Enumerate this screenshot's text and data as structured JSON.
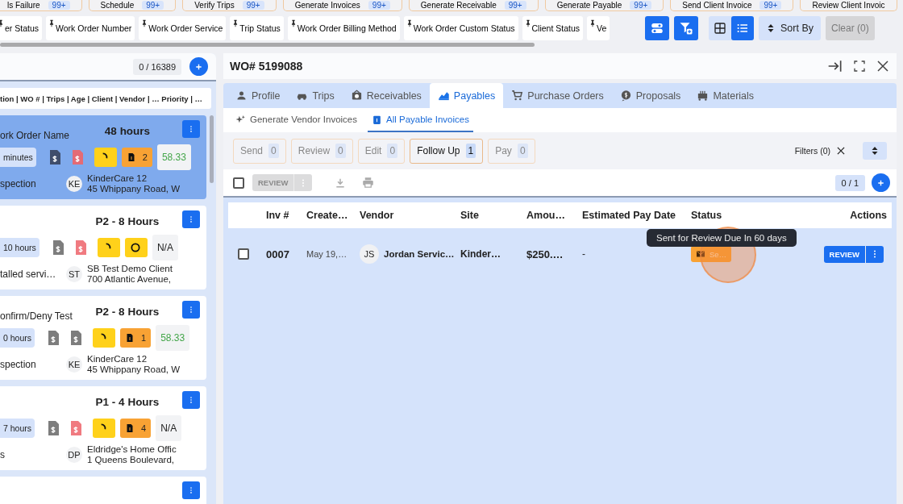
{
  "top_chips": [
    {
      "label": "ls Failure",
      "count": "99+"
    },
    {
      "label": "Schedule",
      "count": "99+"
    },
    {
      "label": "Verify Trips",
      "count": "99+"
    },
    {
      "label": "Generate Invoices",
      "count": "99+"
    },
    {
      "label": "Generate Receivable",
      "count": "99+"
    },
    {
      "label": "Generate Payable",
      "count": "99+"
    },
    {
      "label": "Send Client Invoice",
      "count": "99+"
    },
    {
      "label": "Review Client Invoic"
    }
  ],
  "pinned_filters": [
    "er Status",
    "Work Order Number",
    "Work Order Service",
    "Trip Status",
    "Work Order Billing Method",
    "Work Order Custom Status",
    "Client Status",
    "Ve"
  ],
  "toolbar": {
    "views": [
      {
        "kind": "grid",
        "selected": false
      },
      {
        "kind": "list",
        "selected": true
      }
    ],
    "sort_label": "Sort By",
    "clear_label": "Clear (0)",
    "clear_disabled": true
  },
  "list": {
    "count": "0 / 16389",
    "columns_label": "tion | WO # | Trips | Age | Client | Vendor | …  Priority | …",
    "cards": [
      {
        "selected": true,
        "name": "ork Order Name",
        "priority": "48 hours",
        "age": "minutes",
        "invoice_icons": [
          {
            "color": "#3f4d6b"
          },
          {
            "color": "#e46b75"
          }
        ],
        "badges": [
          {
            "kind": "spinner"
          },
          {
            "kind": "docs",
            "count": "2"
          },
          {
            "kind": "percent",
            "text": "58.33"
          }
        ],
        "service": "spection",
        "initials": "KE",
        "site": "KinderCare 12",
        "address": "45 Whippany Road, W"
      },
      {
        "selected": false,
        "priority": "P2 - 8 Hours",
        "age": "10 hours",
        "invoice_icons": [
          {
            "color": "#7d7d7d"
          },
          {
            "color": "#f07a80"
          }
        ],
        "badges": [
          {
            "kind": "spinner"
          },
          {
            "kind": "ring"
          },
          {
            "kind": "na",
            "text": "N/A"
          }
        ],
        "service": "talled servi…",
        "initials": "ST",
        "site": "SB Test Demo Client",
        "address": "700 Atlantic Avenue,"
      },
      {
        "selected": false,
        "name": "onfirm/Deny Test",
        "priority": "P2 - 8 Hours",
        "age": "0 hours",
        "invoice_icons": [
          {
            "color": "#7d7d7d"
          },
          {
            "color": "#7d7d7d"
          }
        ],
        "badges": [
          {
            "kind": "spinner"
          },
          {
            "kind": "docs",
            "count": "1"
          },
          {
            "kind": "percent",
            "text": "58.33"
          }
        ],
        "service": "spection",
        "initials": "KE",
        "site": "KinderCare 12",
        "address": "45 Whippany Road, W"
      },
      {
        "selected": false,
        "priority": "P1 - 4 Hours",
        "age": "7 hours",
        "invoice_icons": [
          {
            "color": "#7d7d7d"
          },
          {
            "color": "#f07a80"
          }
        ],
        "badges": [
          {
            "kind": "spinner"
          },
          {
            "kind": "docs",
            "count": "4"
          },
          {
            "kind": "na",
            "text": "N/A"
          }
        ],
        "service": "s",
        "initials": "DP",
        "site": "Eldridge's Home Offic",
        "address": "1 Queens Boulevard,"
      },
      {
        "selected": false
      }
    ]
  },
  "detail": {
    "title": "WO# 5199088",
    "tabs": [
      {
        "label": "Profile",
        "selected": false
      },
      {
        "label": "Trips",
        "selected": false
      },
      {
        "label": "Receivables",
        "selected": false
      },
      {
        "label": "Payables",
        "selected": true
      },
      {
        "label": "Purchase Orders",
        "selected": false
      },
      {
        "label": "Proposals",
        "selected": false
      },
      {
        "label": "Materials",
        "selected": false
      }
    ],
    "subtabs": [
      {
        "label": "Generate Vendor Invoices",
        "selected": false
      },
      {
        "label": "All Payable Invoices",
        "selected": true
      }
    ],
    "stages": [
      {
        "label": "Send",
        "count": "0",
        "selected": false
      },
      {
        "label": "Review",
        "count": "0",
        "selected": false
      },
      {
        "label": "Edit",
        "count": "0",
        "selected": false
      },
      {
        "label": "Follow Up",
        "count": "1",
        "selected": true
      },
      {
        "label": "Pay",
        "count": "0",
        "selected": false
      }
    ],
    "filters_label": "Filters (0)",
    "select_all_checked": false,
    "bulk_action": {
      "label": "REVIEW",
      "disabled": true
    },
    "page_count": "0 / 1",
    "table": {
      "columns": [
        "Inv #",
        "Create…",
        "Vendor",
        "Site",
        "Amou…",
        "Estimated Pay Date",
        "Status",
        "Actions"
      ],
      "rows": [
        {
          "checked": false,
          "inv": "0007",
          "created": "May 19,…",
          "initials": "JS",
          "vendor": "Jordan Servic…",
          "site": "Kinder…",
          "amount": "$250.…",
          "pay_date": "-",
          "status": "Se…",
          "action": "REVIEW"
        }
      ]
    },
    "tooltip": "Sent for Review Due In 60 days"
  }
}
